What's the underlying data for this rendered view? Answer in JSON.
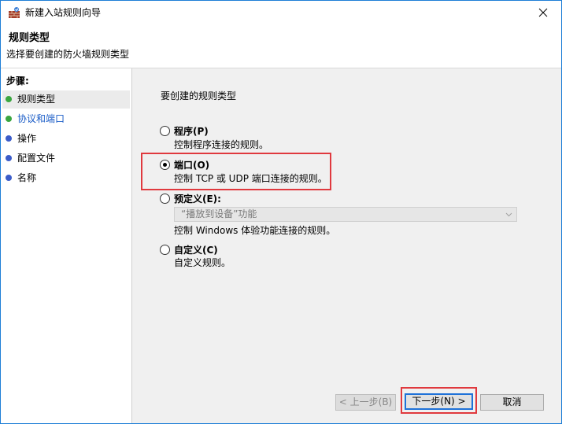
{
  "window": {
    "title": "新建入站规则向导",
    "close_icon": "close-icon",
    "app_icon": "firewall-icon"
  },
  "header": {
    "title": "规则类型",
    "subtitle": "选择要创建的防火墙规则类型"
  },
  "steps": {
    "title": "步骤:",
    "items": [
      {
        "label": "规则类型",
        "dot_color": "#3aa640",
        "active": true
      },
      {
        "label": "协议和端口",
        "dot_color": "#3aa640",
        "link": true
      },
      {
        "label": "操作",
        "dot_color": "#3b5cc9"
      },
      {
        "label": "配置文件",
        "dot_color": "#3b5cc9"
      },
      {
        "label": "名称",
        "dot_color": "#3b5cc9"
      }
    ]
  },
  "main": {
    "prompt": "要创建的规则类型",
    "options": [
      {
        "label": "程序(P)",
        "desc": "控制程序连接的规则。",
        "checked": false
      },
      {
        "label": "端口(O)",
        "desc": "控制 TCP 或 UDP 端口连接的规则。",
        "checked": true
      },
      {
        "label": "预定义(E):",
        "select_value": "“播放到设备”功能",
        "desc": "控制 Windows 体验功能连接的规则。",
        "checked": false
      },
      {
        "label": "自定义(C)",
        "desc": "自定义规则。",
        "checked": false
      }
    ]
  },
  "buttons": {
    "back": "< 上一步(B)",
    "next": "下一步(N) >",
    "cancel": "取消"
  },
  "colors": {
    "highlight": "#e0393e",
    "accent": "#1f72d8"
  }
}
